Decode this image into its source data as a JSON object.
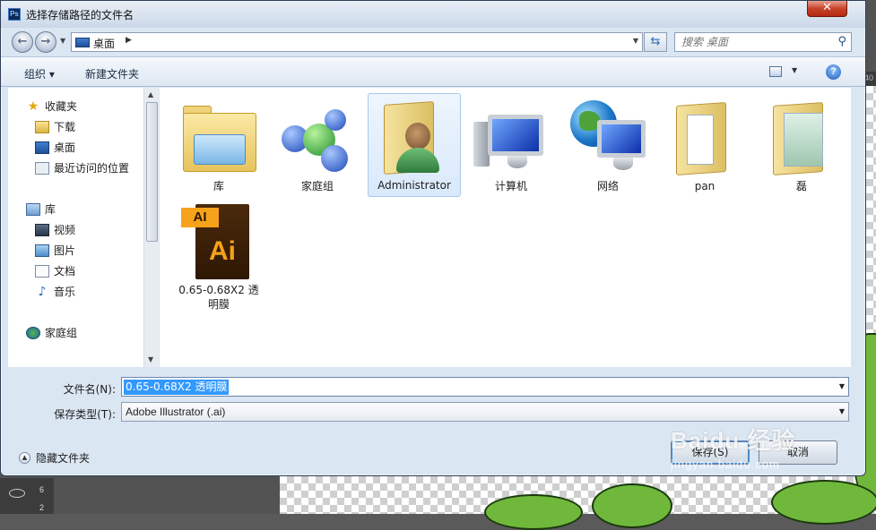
{
  "window": {
    "title": "选择存储路径的文件名",
    "close_glyph": "✕"
  },
  "address_bar": {
    "location": "桌面",
    "search_placeholder": "搜索 桌面"
  },
  "toolbar": {
    "organize_label": "组织 ▾",
    "new_folder_label": "新建文件夹"
  },
  "nav_pane": {
    "favorites": {
      "label": "收藏夹",
      "items": [
        {
          "label": "下载",
          "icon": "download-folder-icon"
        },
        {
          "label": "桌面",
          "icon": "desktop-icon"
        },
        {
          "label": "最近访问的位置",
          "icon": "recent-places-icon"
        }
      ]
    },
    "libraries": {
      "label": "库",
      "items": [
        {
          "label": "视频",
          "icon": "video-icon"
        },
        {
          "label": "图片",
          "icon": "pictures-icon"
        },
        {
          "label": "文档",
          "icon": "documents-icon"
        },
        {
          "label": "音乐",
          "icon": "music-icon"
        }
      ]
    },
    "homegroup": {
      "label": "家庭组"
    }
  },
  "files": [
    {
      "name": "库",
      "icon": "libraries-folder-icon"
    },
    {
      "name": "家庭组",
      "icon": "homegroup-icon"
    },
    {
      "name": "Administrator",
      "icon": "user-folder-icon",
      "selected": true
    },
    {
      "name": "计算机",
      "icon": "computer-icon"
    },
    {
      "name": "网络",
      "icon": "network-icon"
    },
    {
      "name": "pan",
      "icon": "folder-icon"
    },
    {
      "name": "磊",
      "icon": "folder-icon"
    },
    {
      "name": "0.65-0.68X2  透明膜",
      "icon": "illustrator-file-icon",
      "tag": "AI",
      "glyph": "Ai"
    }
  ],
  "form": {
    "filename_label": "文件名(N):",
    "filename_value": "0.65-0.68X2  透明膜",
    "filetype_label": "保存类型(T):",
    "filetype_value": "Adobe Illustrator (.ai)"
  },
  "footer": {
    "hide_folders_label": "隐藏文件夹",
    "save_label": "保存(S)",
    "cancel_label": "取消"
  },
  "watermark": {
    "main": "Baidu 经验",
    "sub": "jingyan.baidu.com"
  },
  "background": {
    "ruler_value": "40",
    "panel_numbers": [
      "6",
      "2"
    ]
  }
}
